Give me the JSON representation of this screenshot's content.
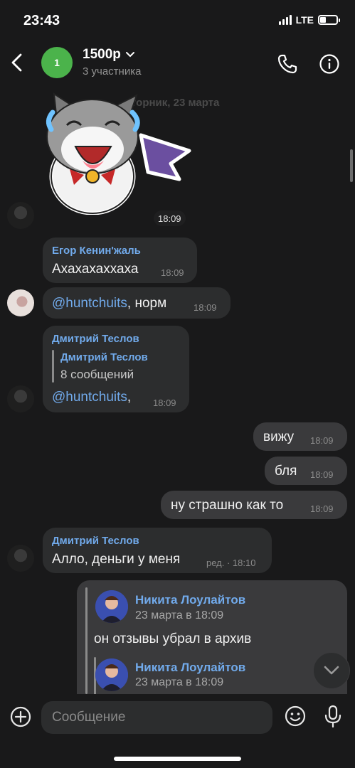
{
  "status_bar": {
    "time": "23:43",
    "network": "LTE",
    "battery_level": 0.35
  },
  "header": {
    "avatar_text": "1",
    "title": "1500р",
    "subtitle": "3 участника",
    "accent": "#4bb34b"
  },
  "date_separator": "вторник, 23 марта",
  "sticker": {
    "time": "18:09"
  },
  "messages": [
    {
      "sender": "Егор Кенин'жаль",
      "text": "Ахахахаххаха",
      "time": "18:09"
    },
    {
      "mention": "@huntchuits",
      "text": ", норм",
      "time": "18:09"
    },
    {
      "sender": "Дмитрий Теслов",
      "quote_sender": "Дмитрий Теслов",
      "quote_text": "8 сообщений",
      "mention": "@huntchuits",
      "text": ",",
      "time": "18:09"
    },
    {
      "text": "вижу",
      "time": "18:09"
    },
    {
      "text": "бля",
      "time": "18:09"
    },
    {
      "text": "ну страшно как то",
      "time": "18:09"
    },
    {
      "sender": "Дмитрий Теслов",
      "text": "Алло, деньги у меня",
      "time": "ред. · 18:10"
    },
    {
      "forwards": [
        {
          "name": "Никита Лоулайтов",
          "date": "23 марта в 18:09",
          "text": "он отзывы убрал в архив"
        },
        {
          "name": "Никита Лоулайтов",
          "date": "23 марта в 18:09"
        }
      ]
    }
  ],
  "composer": {
    "placeholder": "Сообщение"
  },
  "colors": {
    "background": "#19191a",
    "bubble_in": "#2c2d2e",
    "bubble_out": "#3a3a3c",
    "link": "#71aaeb"
  },
  "icons": [
    "back-icon",
    "chevron-down-icon",
    "phone-icon",
    "info-icon",
    "plus-icon",
    "emoji-icon",
    "microphone-icon",
    "chevron-down-icon"
  ]
}
